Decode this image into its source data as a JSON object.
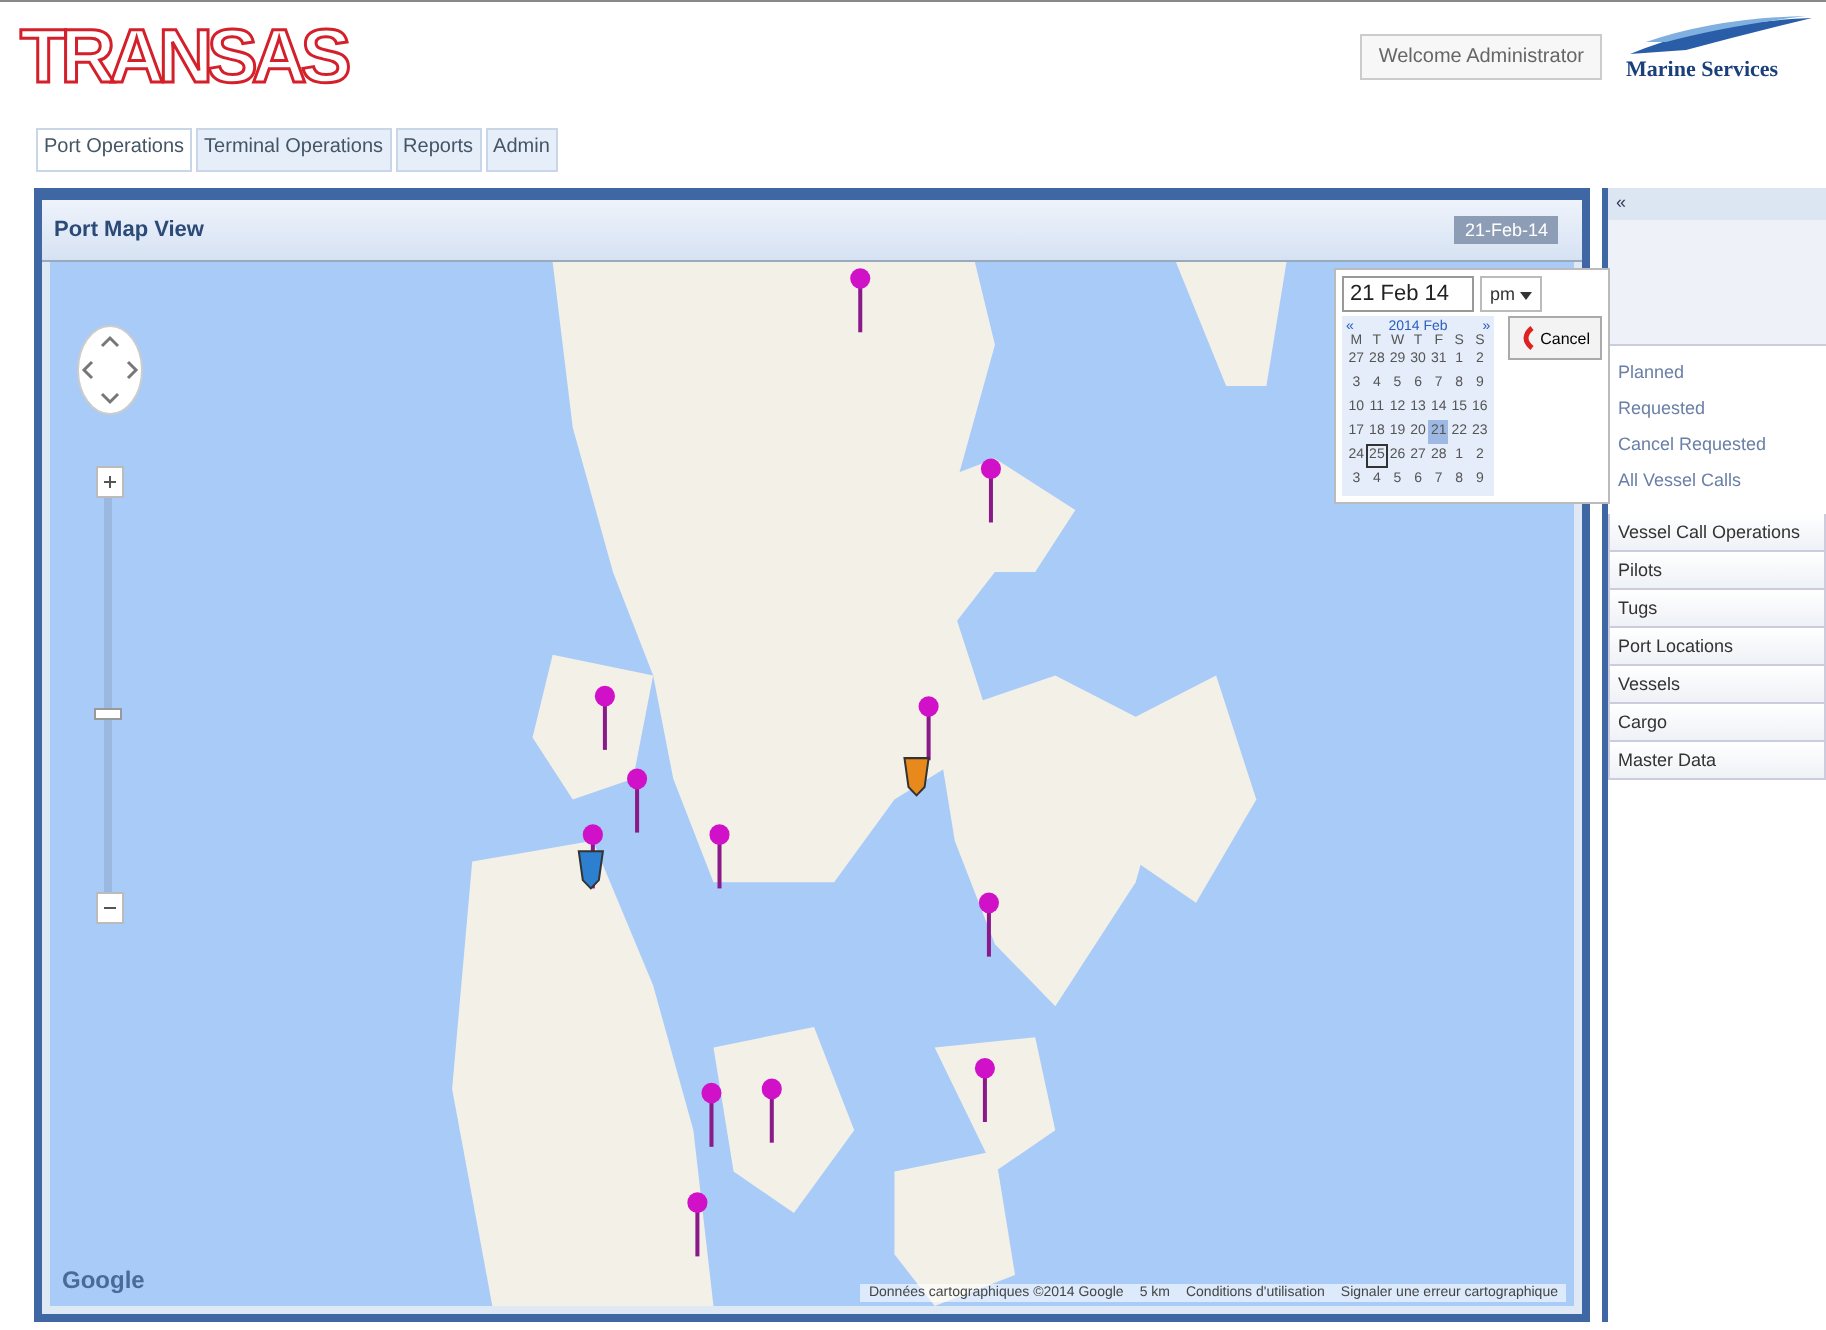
{
  "header": {
    "logo": "TRANSAS",
    "welcome": "Welcome Administrator",
    "brand": "Marine Services"
  },
  "tabs": [
    {
      "label": "Port Operations",
      "selected": true
    },
    {
      "label": "Terminal Operations",
      "selected": false
    },
    {
      "label": "Reports",
      "selected": false
    },
    {
      "label": "Admin",
      "selected": false
    }
  ],
  "map_panel": {
    "title": "Port Map View",
    "date_field": "21-Feb-14",
    "map_logo": "Google",
    "zoom": {
      "level": 0.45
    },
    "attribution": [
      "Données cartographiques ©2014 Google",
      "5 km",
      "Conditions d'utilisation",
      "Signaler une erreur cartographique"
    ]
  },
  "date_picker": {
    "value": "21 Feb 14",
    "meridiem": "pm",
    "prev": "«",
    "month": "2014 Feb",
    "next": "»",
    "cancel": "Cancel",
    "weekdays": [
      "M",
      "T",
      "W",
      "T",
      "F",
      "S",
      "S"
    ],
    "weeks": [
      [
        {
          "day": "27",
          "selected": false,
          "today": false
        },
        {
          "day": "28",
          "selected": false,
          "today": false
        },
        {
          "day": "29",
          "selected": false,
          "today": false
        },
        {
          "day": "30",
          "selected": false,
          "today": false
        },
        {
          "day": "31",
          "selected": false,
          "today": false
        },
        {
          "day": "1",
          "selected": false,
          "today": false
        },
        {
          "day": "2",
          "selected": false,
          "today": false
        }
      ],
      [
        {
          "day": "3",
          "selected": false,
          "today": false
        },
        {
          "day": "4",
          "selected": false,
          "today": false
        },
        {
          "day": "5",
          "selected": false,
          "today": false
        },
        {
          "day": "6",
          "selected": false,
          "today": false
        },
        {
          "day": "7",
          "selected": false,
          "today": false
        },
        {
          "day": "8",
          "selected": false,
          "today": false
        },
        {
          "day": "9",
          "selected": false,
          "today": false
        }
      ],
      [
        {
          "day": "10",
          "selected": false,
          "today": false
        },
        {
          "day": "11",
          "selected": false,
          "today": false
        },
        {
          "day": "12",
          "selected": false,
          "today": false
        },
        {
          "day": "13",
          "selected": false,
          "today": false
        },
        {
          "day": "14",
          "selected": false,
          "today": false
        },
        {
          "day": "15",
          "selected": false,
          "today": false
        },
        {
          "day": "16",
          "selected": false,
          "today": false
        }
      ],
      [
        {
          "day": "17",
          "selected": false,
          "today": false
        },
        {
          "day": "18",
          "selected": false,
          "today": false
        },
        {
          "day": "19",
          "selected": false,
          "today": false
        },
        {
          "day": "20",
          "selected": false,
          "today": false
        },
        {
          "day": "21",
          "selected": true,
          "today": false
        },
        {
          "day": "22",
          "selected": false,
          "today": false
        },
        {
          "day": "23",
          "selected": false,
          "today": false
        }
      ],
      [
        {
          "day": "24",
          "selected": false,
          "today": false
        },
        {
          "day": "25",
          "selected": false,
          "today": true
        },
        {
          "day": "26",
          "selected": false,
          "today": false
        },
        {
          "day": "27",
          "selected": false,
          "today": false
        },
        {
          "day": "28",
          "selected": false,
          "today": false
        },
        {
          "day": "1",
          "selected": false,
          "today": false
        },
        {
          "day": "2",
          "selected": false,
          "today": false
        }
      ],
      [
        {
          "day": "3",
          "selected": false,
          "today": false
        },
        {
          "day": "4",
          "selected": false,
          "today": false
        },
        {
          "day": "5",
          "selected": false,
          "today": false
        },
        {
          "day": "6",
          "selected": false,
          "today": false
        },
        {
          "day": "7",
          "selected": false,
          "today": false
        },
        {
          "day": "8",
          "selected": false,
          "today": false
        },
        {
          "day": "9",
          "selected": false,
          "today": false
        }
      ]
    ]
  },
  "sidebar": {
    "collapse": "«",
    "filters": [
      "Planned",
      "Requested",
      "Cancel Requested",
      "All Vessel Calls"
    ],
    "sections": [
      "Vessel Call Operations",
      "Pilots",
      "Tugs",
      "Port Locations",
      "Vessels",
      "Cargo",
      "Master Data"
    ]
  }
}
